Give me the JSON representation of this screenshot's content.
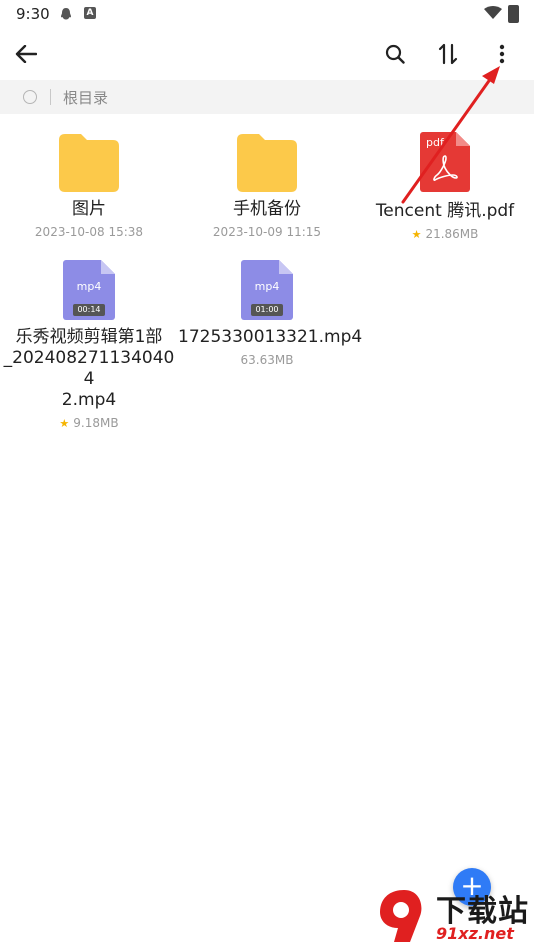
{
  "status_bar": {
    "time": "9:30",
    "app_badge": "A"
  },
  "path": {
    "label": "根目录"
  },
  "files": [
    {
      "name": "图片",
      "meta": "2023-10-08 15:38"
    },
    {
      "name": "手机备份",
      "meta": "2023-10-09 11:15"
    },
    {
      "name": "Tencent 腾讯.pdf",
      "meta": "21.86MB",
      "type_label": "pdf"
    },
    {
      "name": "乐秀视频剪辑第1部_20240827113404042.mp4",
      "name_lines": [
        "乐秀视频剪辑第1部",
        "_202408271134040 4",
        "2.mp4"
      ],
      "meta": "9.18MB",
      "type_label": "mp4",
      "duration": "00:14"
    },
    {
      "name": "1725330013321.mp4",
      "meta": "63.63MB",
      "type_label": "mp4",
      "duration": "01:00"
    }
  ],
  "colors": {
    "accent": "#2f7bf6",
    "folder": "#fcc94a",
    "video": "#8d8ce6",
    "pdf": "#e53935",
    "annotation": "#e02020"
  },
  "icons": {
    "back": "back-arrow-icon",
    "search": "search-icon",
    "sort": "sort-icon",
    "more": "more-vert-icon",
    "fab": "plus-icon"
  },
  "watermark": {
    "text": "下载站",
    "url": "91xz.net"
  }
}
